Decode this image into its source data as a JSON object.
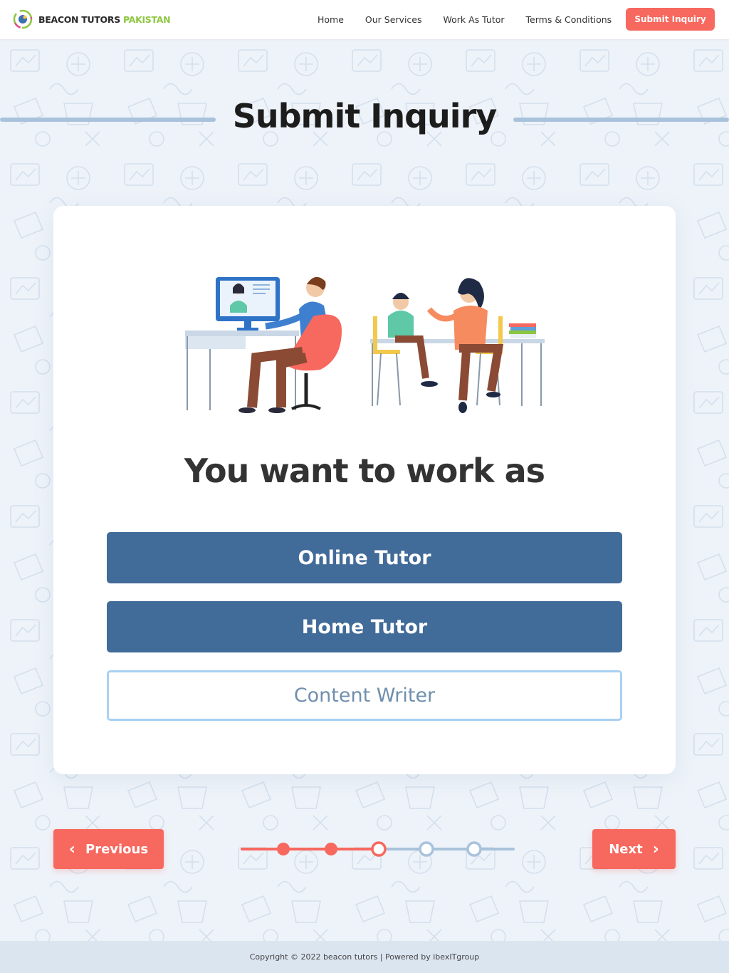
{
  "header": {
    "brand_part1": "BEACON TUTORS",
    "brand_part2": "PAKISTAN",
    "nav": [
      "Home",
      "Our Services",
      "Work As Tutor",
      "Terms & Conditions"
    ],
    "cta_label": "Submit Inquiry"
  },
  "page": {
    "title": "Submit Inquiry"
  },
  "card": {
    "question": "You want to work as",
    "options": [
      "Online Tutor",
      "Home Tutor",
      "Content Writer"
    ]
  },
  "controls": {
    "previous_label": "Previous",
    "next_label": "Next",
    "steps_total": 5,
    "steps_completed": 2,
    "current_step": 3
  },
  "footer": {
    "copyright": "Copyright © 2022 beacon tutors | Powered by ibexITgroup"
  },
  "colors": {
    "accent": "#f7685e",
    "primary": "#416b98",
    "outline": "#a8d1f3",
    "step_inactive": "#a9c2dc"
  }
}
